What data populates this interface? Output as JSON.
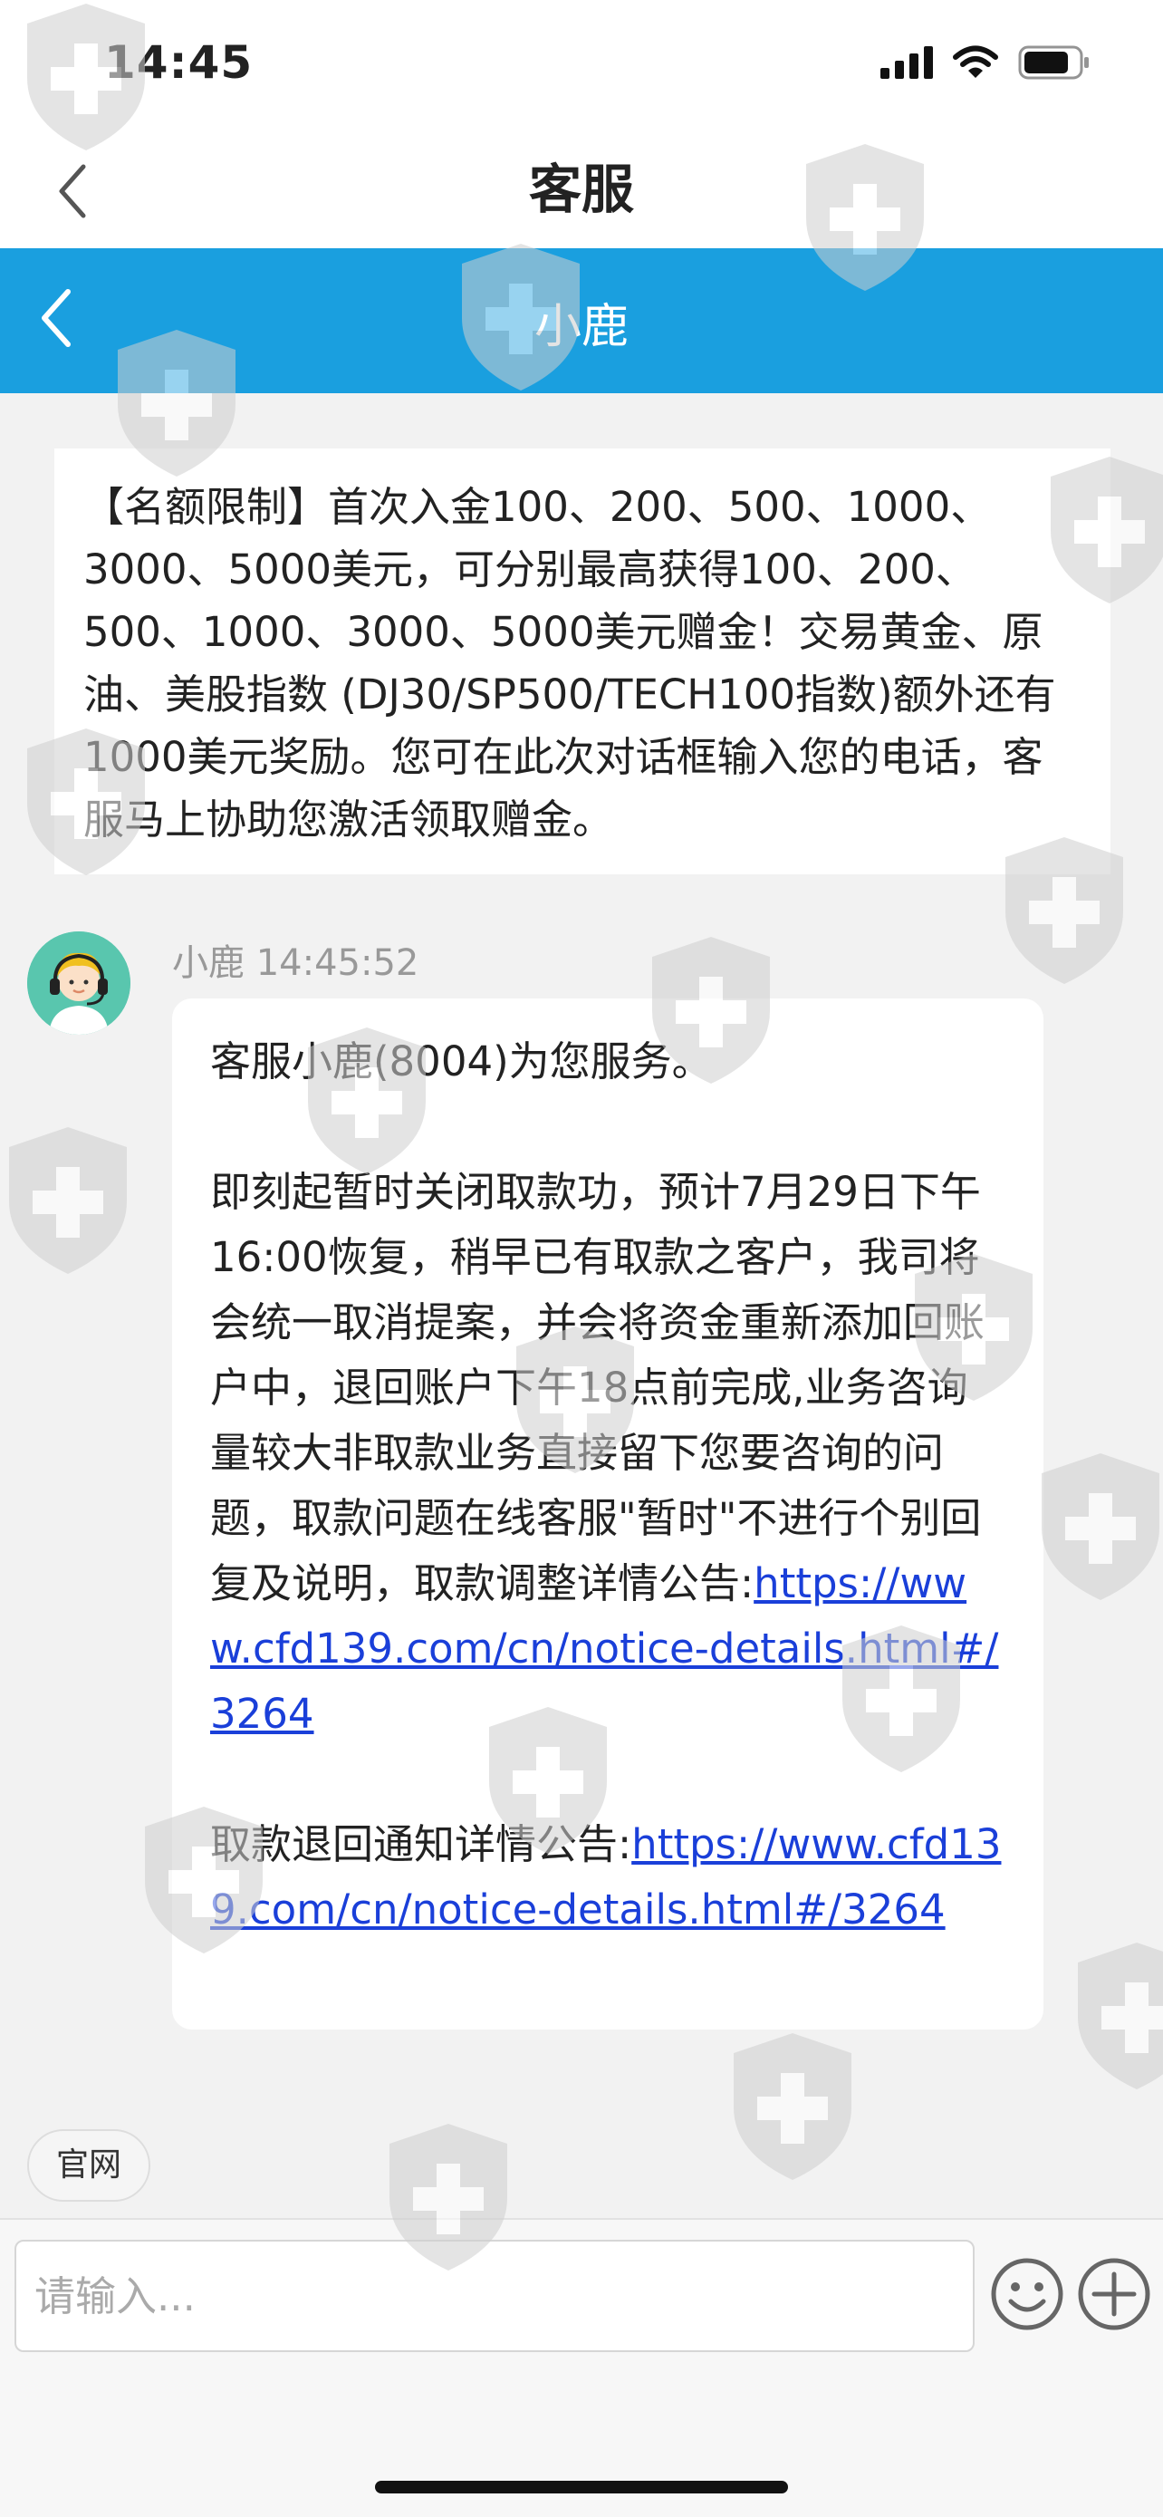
{
  "status_bar": {
    "time": "14:45"
  },
  "nav": {
    "title": "客服"
  },
  "chat": {
    "title": "小鹿"
  },
  "notice": {
    "text": "【名额限制】首次入金100、200、500、1000、3000、5000美元，可分别最高获得100、200、500、1000、3000、5000美元赠金！交易黄金、原油、美股指数 (DJ30/SP500/TECH100指数)额外还有1000美元奖励。您可在此次对话框输入您的电话，客服马上协助您激活领取赠金。"
  },
  "message": {
    "sender_time": "小鹿 14:45:52",
    "line1": "客服小鹿(8004)为您服务。",
    "paragraph2": "即刻起暂时关闭取款功，预计7月29日下午16:00恢复，稍早已有取款之客户，我司将会统一取消提案，并会将资金重新添加回账户中，退回账户下午18点前完成,业务咨询量较大非取款业务直接留下您要咨询的问题，取款问题在线客服\"暂时\"不进行个别回复及说明，取款调整详情公告:",
    "link1": "https://www.cfd139.com/cn/notice-details.html#/3264",
    "paragraph3": "取款退回通知详情公告:",
    "link2": "https://www.cfd139.com/cn/notice-details.html#/3264"
  },
  "quick_replies": [
    {
      "label": "官网"
    }
  ],
  "input": {
    "placeholder": "请输入..."
  },
  "icons": {
    "back": "chevron-left-icon",
    "signal": "signal-bars-icon",
    "wifi": "wifi-icon",
    "battery": "battery-icon",
    "emoji": "smiley-icon",
    "add": "plus-circle-icon",
    "watermark": "shield-cross-watermark"
  },
  "colors": {
    "accent": "#1a9fdf",
    "link": "#1a3fd9",
    "background": "#f2f2f2"
  }
}
